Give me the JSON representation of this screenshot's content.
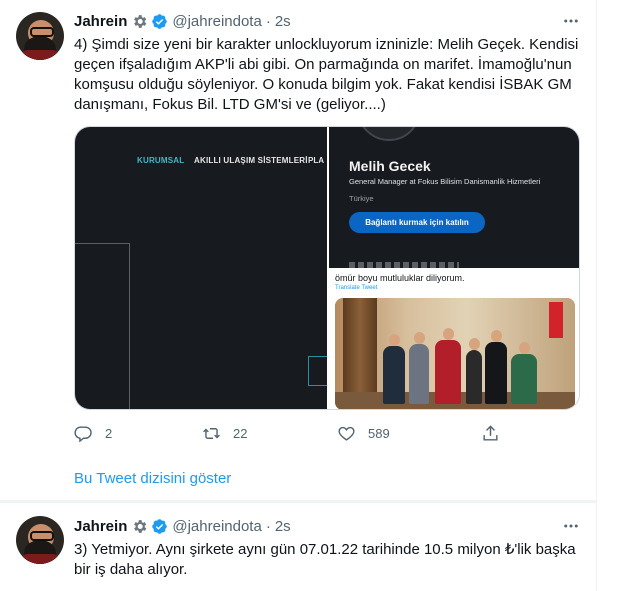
{
  "tweets": [
    {
      "author_name": "Jahrein",
      "handle": "@jahreindota",
      "separator": "·",
      "time": "2s",
      "text": "4) Şimdi size yeni bir karakter unlockluyorum izninizle: Melih Geçek. Kendisi\ngeçen ifşaladığım AKP'li abi gibi. On parmağında on marifet. İmamoğlu'nun\nkomşusu olduğu söyleniyor. O konuda bilgim yok. Fakat kendisi İSBAK GM\ndanışmanı, Fokus Bil. LTD GM'si ve (geliyor....)",
      "media": {
        "website_nav": [
          "KURUMSAL",
          "AKILLI ULAŞIM SİSTEMLERİ",
          "PLA"
        ],
        "profile_name": "Melih Gecek",
        "profile_title": "General Manager at Fokus Bilisim Danismanlik Hizmetleri",
        "profile_country": "Türkiye",
        "connect_label": "Bağlantı kurmak için katılın",
        "embedded_text": "ömür boyu mutluluklar diliyorum.",
        "translate_label": "Translate Tweet"
      },
      "stats": {
        "replies": "2",
        "retweets": "22",
        "likes": "589"
      },
      "show_thread": "Bu Tweet dizisini göster"
    },
    {
      "author_name": "Jahrein",
      "handle": "@jahreindota",
      "separator": "·",
      "time": "2s",
      "text": "3) Yetmiyor. Aynı şirkete aynı gün 07.01.22 tarihinde 10.5 milyon ₺'lik başka\nbir iş daha alıyor."
    }
  ],
  "icons": {
    "verified_color": "#1d9bf0",
    "more": "more-dots-icon",
    "reply": "reply-icon",
    "retweet": "retweet-icon",
    "like": "heart-icon",
    "share": "share-icon"
  },
  "colors": {
    "link": "#1d9bf0",
    "secondary_text": "#536471"
  }
}
